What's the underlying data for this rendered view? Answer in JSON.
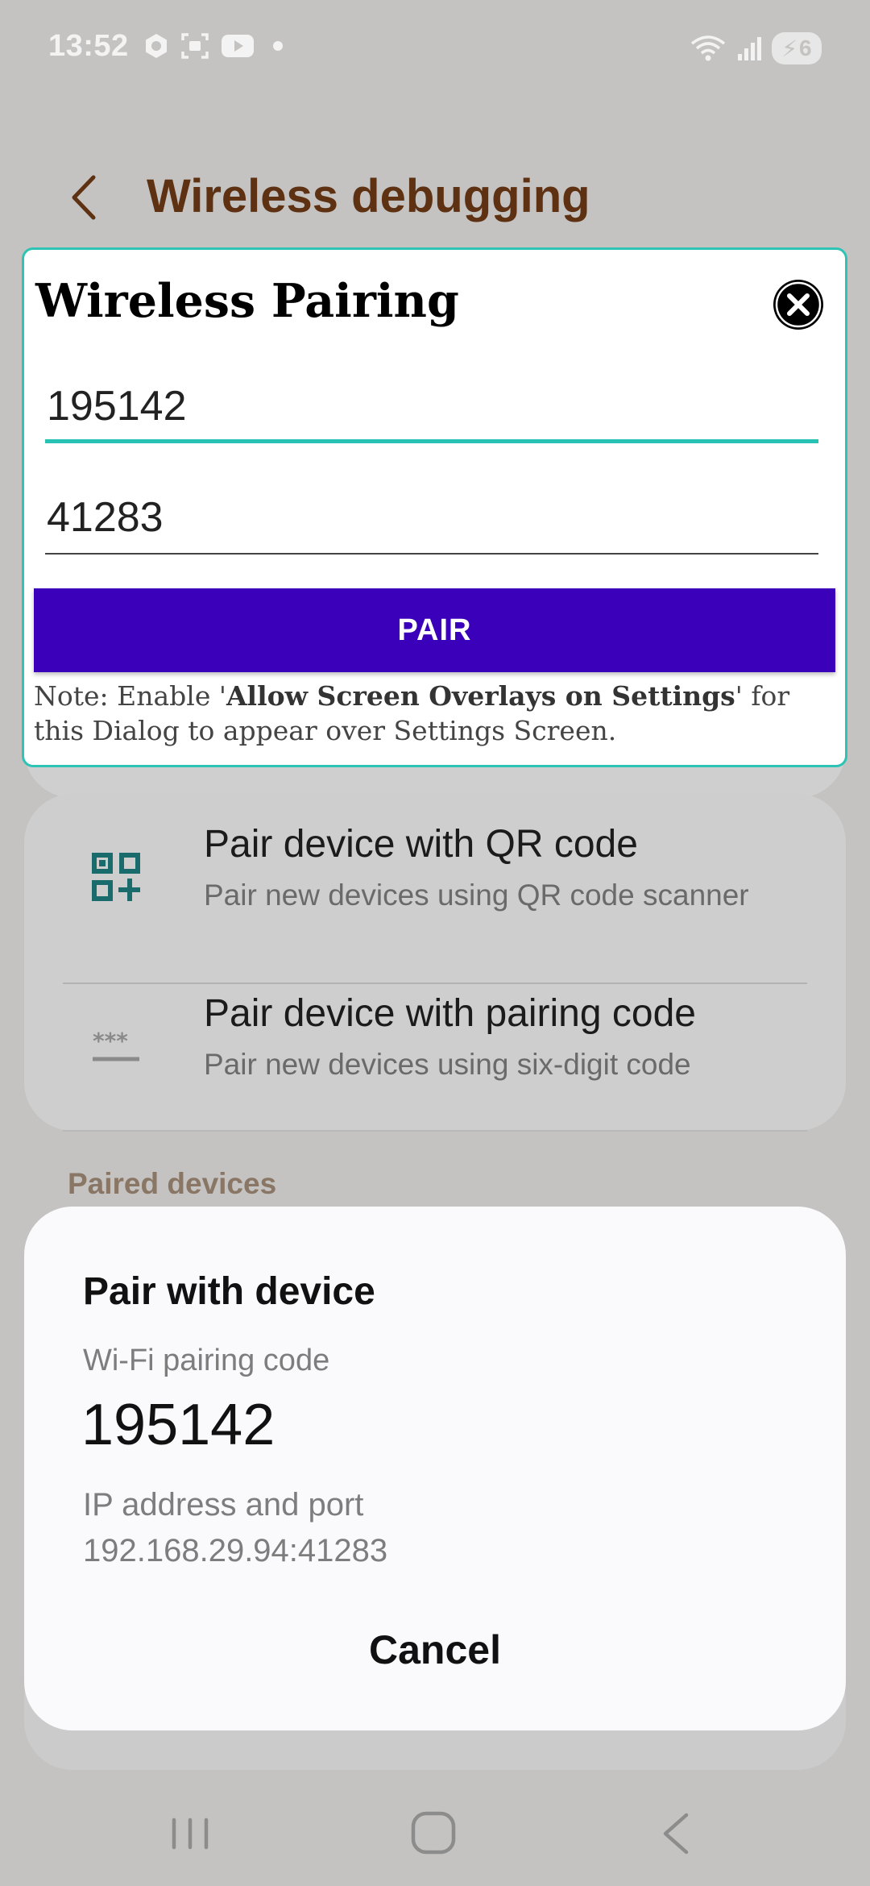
{
  "status_bar": {
    "time": "13:52",
    "battery_level": "6",
    "left_icons": [
      "app-hexagon-icon",
      "screen-capture-icon",
      "youtube-icon",
      "dot-icon"
    ],
    "right_icons": [
      "wifi-icon",
      "signal-icon",
      "battery-charging-icon"
    ]
  },
  "header": {
    "title": "Wireless debugging",
    "back_icon": "chevron-left-icon"
  },
  "pair_dialog": {
    "title": "Wireless Pairing",
    "code_value": "195142",
    "port_value": "41283",
    "pair_button_label": "PAIR",
    "note_prefix": "Note: Enable '",
    "note_bold": "Allow Screen Overlays on Settings",
    "note_suffix": "' for this Dialog to appear over Settings Screen.",
    "accent_color": "#2ec3b4",
    "button_color": "#3b00b9"
  },
  "options": [
    {
      "title": "Pair device with QR code",
      "subtitle": "Pair new devices using QR code scanner",
      "icon": "qr-code-icon"
    },
    {
      "title": "Pair device with pairing code",
      "subtitle": "Pair new devices using six-digit code",
      "icon": "password-icon"
    }
  ],
  "paired_devices_label": "Paired devices",
  "system_dialog": {
    "title": "Pair with device",
    "code_label": "Wi-Fi pairing code",
    "code": "195142",
    "ip_label": "IP address and port",
    "ip": "192.168.29.94:41283",
    "cancel_label": "Cancel"
  },
  "nav_bar": {
    "buttons": [
      "recents-icon",
      "home-icon",
      "back-icon"
    ]
  }
}
